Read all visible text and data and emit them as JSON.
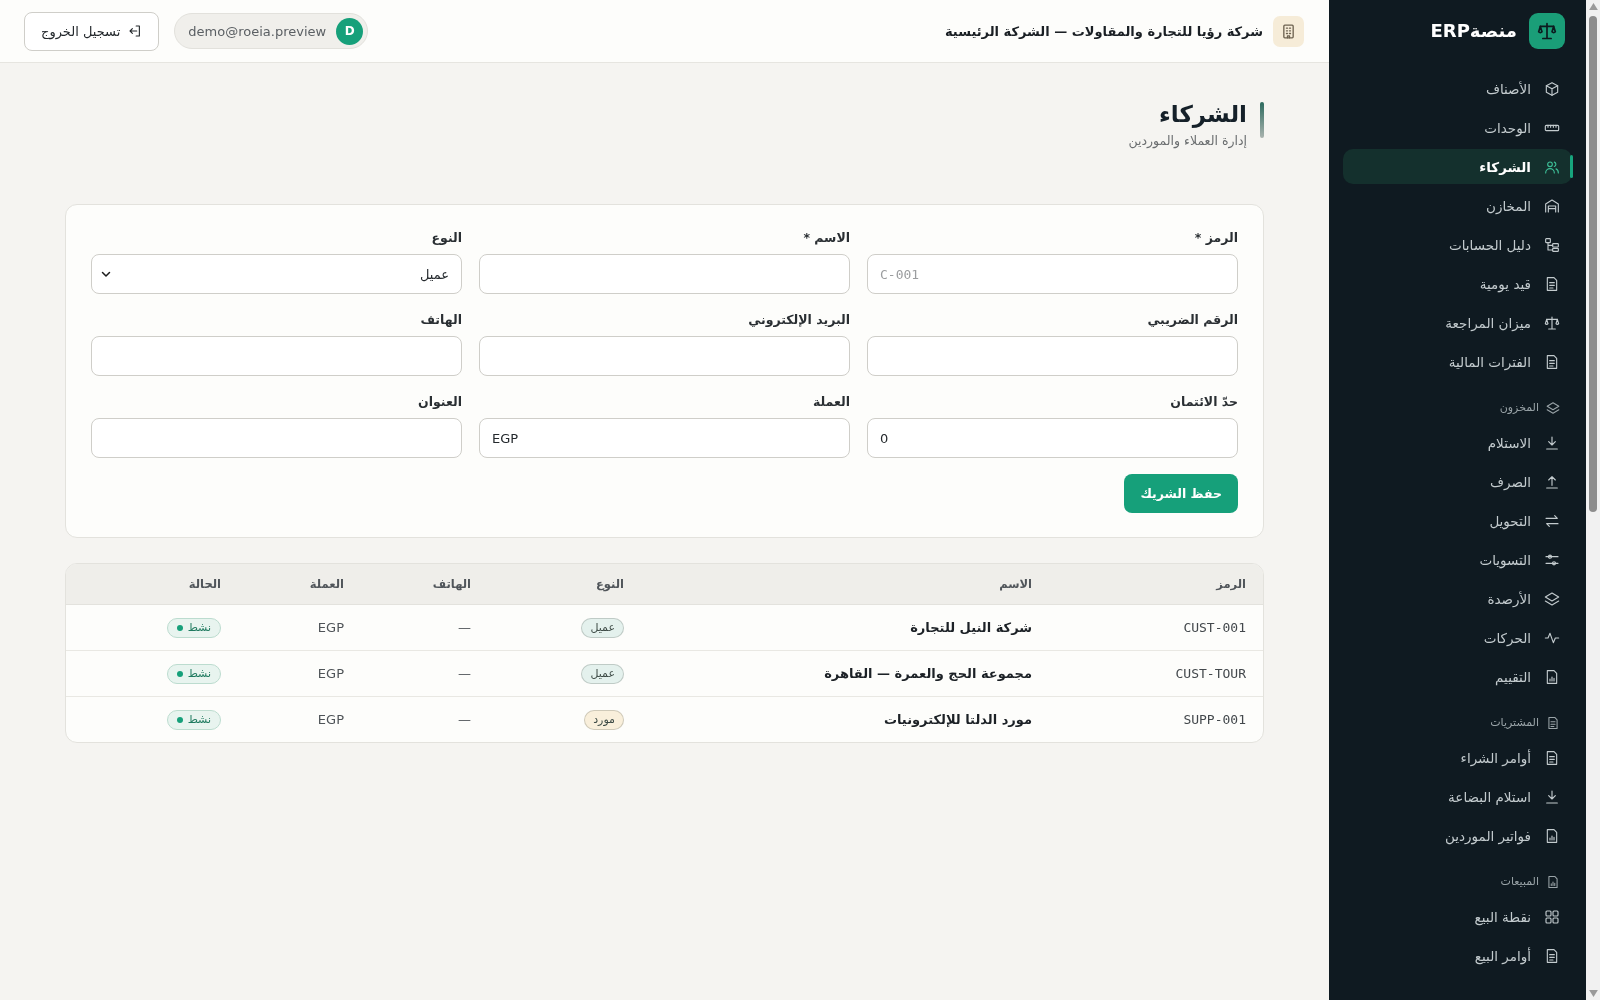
{
  "sidebar": {
    "brand": "منصةERP",
    "sections": [
      {
        "items": [
          {
            "label": "الأصناف",
            "selected": false
          },
          {
            "label": "الوحدات",
            "selected": false
          },
          {
            "label": "الشركاء",
            "selected": true
          },
          {
            "label": "المخازن",
            "selected": false
          },
          {
            "label": "دليل الحسابات",
            "selected": false
          },
          {
            "label": "قيد يومية",
            "selected": false
          },
          {
            "label": "ميزان المراجعة",
            "selected": false
          },
          {
            "label": "الفترات المالية",
            "selected": false
          }
        ]
      },
      {
        "heading": "المخزون",
        "items": [
          {
            "label": "الاستلام",
            "selected": false
          },
          {
            "label": "الصرف",
            "selected": false
          },
          {
            "label": "التحويل",
            "selected": false
          },
          {
            "label": "التسويات",
            "selected": false
          },
          {
            "label": "الأرصدة",
            "selected": false
          },
          {
            "label": "الحركات",
            "selected": false
          },
          {
            "label": "التقييم",
            "selected": false
          }
        ]
      },
      {
        "heading": "المشتريات",
        "items": [
          {
            "label": "أوامر الشراء",
            "selected": false
          },
          {
            "label": "استلام البضاعة",
            "selected": false
          },
          {
            "label": "فواتير الموردين",
            "selected": false
          }
        ]
      },
      {
        "heading": "المبيعات",
        "items": [
          {
            "label": "نقطة البيع",
            "selected": false
          },
          {
            "label": "أوامر البيع",
            "selected": false
          }
        ]
      }
    ]
  },
  "topbar": {
    "company": "شركة رؤيا للتجارة والمقاولات — الشركة الرئيسية",
    "user": {
      "initial": "D",
      "email": "demo@roeia.preview"
    },
    "logout": "تسجيل الخروج"
  },
  "page": {
    "title": "الشركاء",
    "subtitle": "إدارة العملاء والموردين"
  },
  "form": {
    "fields": [
      {
        "label": "الرمز *",
        "kind": "text",
        "placeholder": "C-001"
      },
      {
        "label": "الاسم *",
        "kind": "text"
      },
      {
        "label": "النوع",
        "kind": "select",
        "value": "عميل"
      },
      {
        "label": "الرقم الضريبي",
        "kind": "text"
      },
      {
        "label": "البريد الإلكتروني",
        "kind": "text"
      },
      {
        "label": "الهاتف",
        "kind": "text"
      },
      {
        "label": "حدّ الائتمان",
        "kind": "text",
        "value": "0"
      },
      {
        "label": "العملة",
        "kind": "text",
        "value": "EGP"
      },
      {
        "label": "العنوان",
        "kind": "text"
      }
    ],
    "submit": "حفظ الشريك"
  },
  "table": {
    "columns": [
      "الرمز",
      "الاسم",
      "النوع",
      "الهاتف",
      "العملة",
      "الحالة"
    ],
    "rows": [
      {
        "code": "CUST-001",
        "name": "شركة النيل للتجارة",
        "type": {
          "label": "عميل",
          "color": "#e4f1ed"
        },
        "phone": "—",
        "currency": "EGP",
        "status": {
          "label": "نشط",
          "color": "#16a07a"
        }
      },
      {
        "code": "CUST-TOUR",
        "name": "مجموعة الحج والعمرة — القاهرة",
        "type": {
          "label": "عميل",
          "color": "#e4f1ed"
        },
        "phone": "—",
        "currency": "EGP",
        "status": {
          "label": "نشط",
          "color": "#16a07a"
        }
      },
      {
        "code": "SUPP-001",
        "name": "مورد الدلتا للإلكترونيات",
        "type": {
          "label": "مورد",
          "color": "#f9efdb"
        },
        "phone": "—",
        "currency": "EGP",
        "status": {
          "label": "نشط",
          "color": "#16a07a"
        }
      }
    ]
  }
}
